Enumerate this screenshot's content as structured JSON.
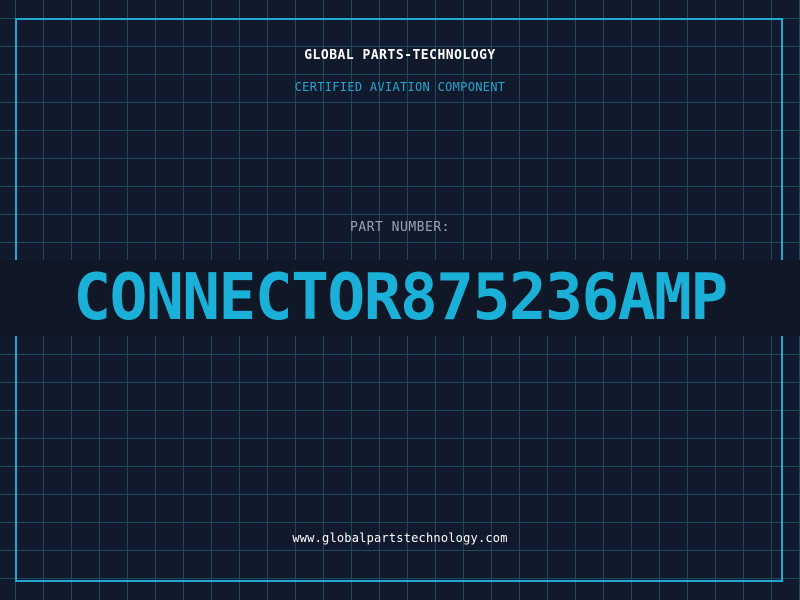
{
  "header": {
    "company": "GLOBAL PARTS-TECHNOLOGY",
    "subtitle": "CERTIFIED AVIATION COMPONENT"
  },
  "part": {
    "label": "PART NUMBER:",
    "number": "CONNECTOR875236AMP"
  },
  "footer": {
    "url": "www.globalpartstechnology.com"
  },
  "colors": {
    "background": "#111a2c",
    "grid": "#1e4a5e",
    "accent": "#22a6d2",
    "part_number": "#1ab0d8",
    "label": "#9aa3b0",
    "text": "#ffffff"
  }
}
